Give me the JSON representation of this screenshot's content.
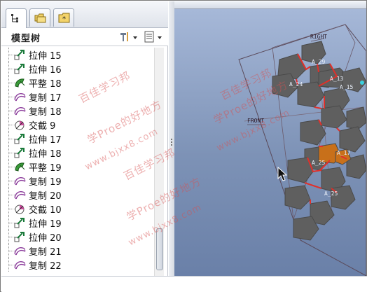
{
  "panel": {
    "title": "模型树"
  },
  "tabs": [
    {
      "name": "model-tree-tab",
      "icon": "model-tree-icon"
    },
    {
      "name": "folder-browser-tab",
      "icon": "folder-icon"
    },
    {
      "name": "favorites-tab",
      "icon": "favorites-folder-icon"
    }
  ],
  "tree_items": [
    {
      "label": "拉伸 15",
      "icon": "extrude-icon"
    },
    {
      "label": "拉伸 16",
      "icon": "extrude-icon"
    },
    {
      "label": "平整 18",
      "icon": "flat-wall-icon"
    },
    {
      "label": "复制 17",
      "icon": "copy-icon"
    },
    {
      "label": "复制 18",
      "icon": "copy-icon"
    },
    {
      "label": "交截 9",
      "icon": "intersect-icon"
    },
    {
      "label": "拉伸 17",
      "icon": "extrude-icon"
    },
    {
      "label": "拉伸 18",
      "icon": "extrude-icon"
    },
    {
      "label": "平整 19",
      "icon": "flat-wall-icon"
    },
    {
      "label": "复制 19",
      "icon": "copy-icon"
    },
    {
      "label": "复制 20",
      "icon": "copy-icon"
    },
    {
      "label": "交截 10",
      "icon": "intersect-icon"
    },
    {
      "label": "拉伸 19",
      "icon": "extrude-icon"
    },
    {
      "label": "拉伸 20",
      "icon": "extrude-icon"
    },
    {
      "label": "复制 21",
      "icon": "copy-icon"
    },
    {
      "label": "复制 22",
      "icon": "copy-icon"
    }
  ],
  "viewport": {
    "datum_labels": [
      "RIGHT",
      "FRONT"
    ],
    "dimension_labels": [
      "A_29",
      "A_24",
      "A_13",
      "A_15",
      "A_25",
      "A_17",
      "A_25"
    ]
  },
  "watermark": {
    "lines": [
      "百佳学习邦",
      "学Proe的好地方",
      "www.bjxx8.com"
    ]
  },
  "colors": {
    "viewport_top": "#a6b8d8",
    "viewport_bottom": "#6a80a8",
    "surface": "#5f5f5f",
    "edge_highlight": "#e0302a",
    "selected_surface": "#c8701a",
    "watermark": "#d65050"
  }
}
